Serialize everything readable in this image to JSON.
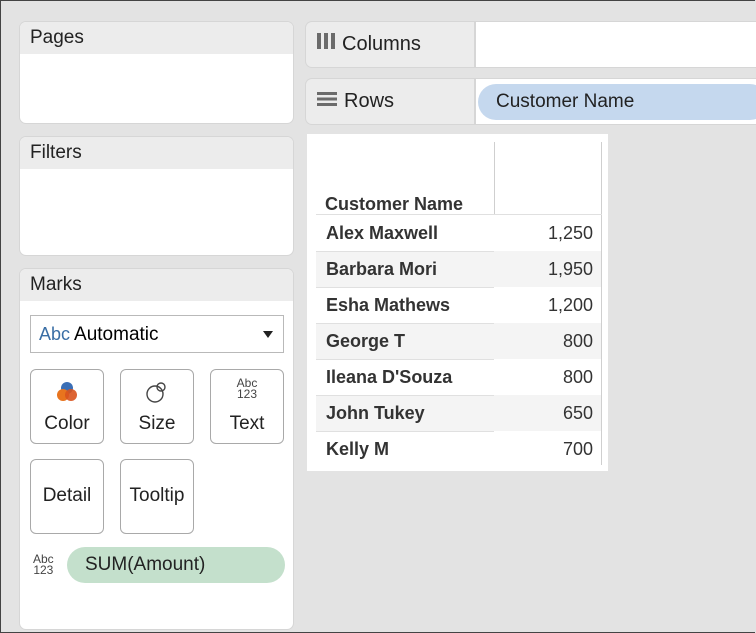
{
  "cards": {
    "pages_title": "Pages",
    "filters_title": "Filters",
    "marks_title": "Marks"
  },
  "shelves": {
    "columns_label": "Columns",
    "rows_label": "Rows",
    "rows_pill": "Customer Name"
  },
  "marks": {
    "type_abc": "Abc",
    "type_value": "Automatic",
    "buttons": {
      "color": "Color",
      "size": "Size",
      "text": "Text",
      "detail": "Detail",
      "tooltip": "Tooltip"
    },
    "text_icon_top": "Abc",
    "text_icon_bottom": "123",
    "field_pill": "SUM(Amount)",
    "color_icon_colors": [
      "#e8741e",
      "#3b6fb6"
    ]
  },
  "table": {
    "header": "Customer Name",
    "rows": [
      {
        "name": "Alex Maxwell",
        "value": "1,250"
      },
      {
        "name": "Barbara Mori",
        "value": "1,950"
      },
      {
        "name": "Esha Mathews",
        "value": "1,200"
      },
      {
        "name": "George T",
        "value": "800"
      },
      {
        "name": "Ileana D'Souza",
        "value": "800"
      },
      {
        "name": "John Tukey",
        "value": "650"
      },
      {
        "name": "Kelly M",
        "value": "700"
      }
    ]
  }
}
